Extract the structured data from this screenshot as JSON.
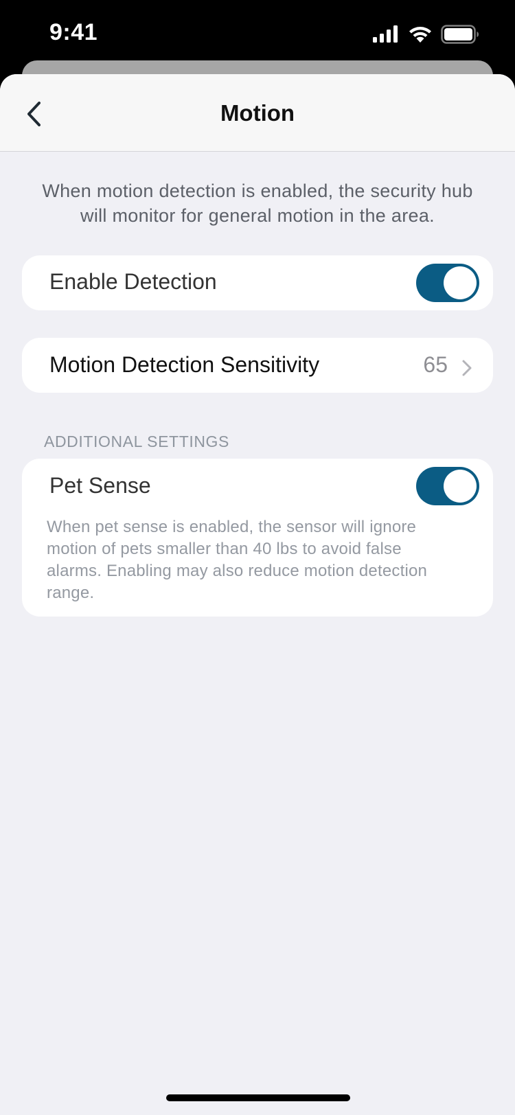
{
  "status_bar": {
    "time": "9:41",
    "icons": [
      "signal-icon",
      "wifi-icon",
      "battery-icon"
    ]
  },
  "nav": {
    "title": "Motion",
    "back_icon": "chevron-left-icon"
  },
  "intro": "When motion detection is enabled, the security hub will monitor for general motion in the area.",
  "enable_detection": {
    "label": "Enable Detection",
    "enabled": true
  },
  "sensitivity": {
    "label": "Motion Detection Sensitivity",
    "value": "65"
  },
  "additional": {
    "header": "ADDITIONAL SETTINGS",
    "pet_sense": {
      "label": "Pet Sense",
      "enabled": true,
      "description": "When pet sense is enabled, the sensor will ignore motion of pets smaller than 40 lbs to avoid false alarms. Enabling may also reduce motion detection range."
    }
  },
  "colors": {
    "accent": "#0b5c84",
    "background": "#f0f0f5",
    "card": "#ffffff"
  }
}
